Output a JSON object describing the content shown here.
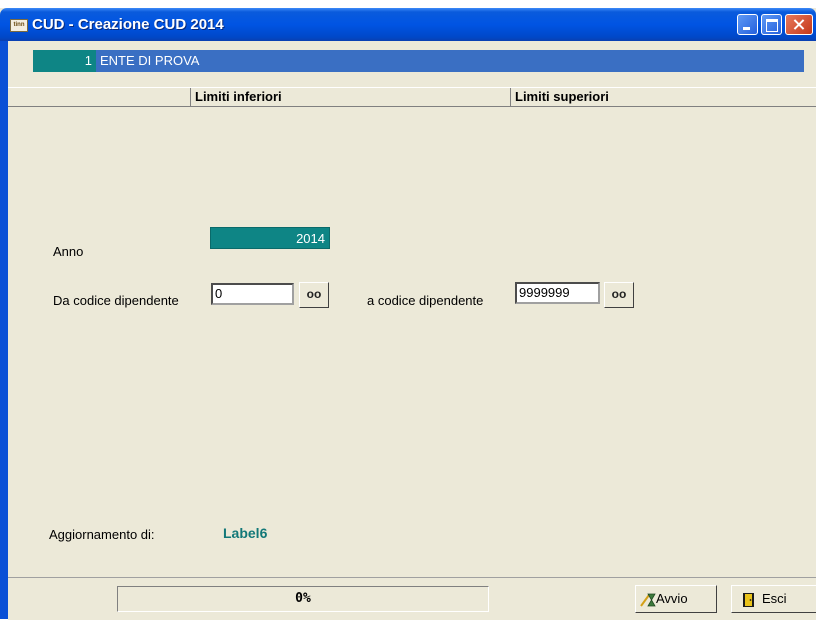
{
  "window": {
    "title": "CUD - Creazione CUD 2014",
    "icon_text": "tinn"
  },
  "ente": {
    "code": "1",
    "name": "ENTE DI PROVA"
  },
  "columns": {
    "lower": "Limiti inferiori",
    "upper": "Limiti superiori"
  },
  "form": {
    "anno_label": "Anno",
    "anno_value": "2014",
    "from_label": "Da codice dipendente",
    "from_value": "0",
    "to_label": "a codice dipendente",
    "to_value": "9999999",
    "lookup_glyph": "oo"
  },
  "update": {
    "label": "Aggiornamento di:",
    "value": "Label6"
  },
  "status": {
    "progress_text": "0%",
    "progress_fraction": 0
  },
  "buttons": {
    "avvio": "Avvio",
    "esci": "Esci"
  },
  "colors": {
    "teal": "#0e8585",
    "ente_bar": "#3a6fc3",
    "label6": "#127878",
    "titlebar": "#0054e3"
  },
  "icons": [
    "window-app-icon",
    "minimize-icon",
    "maximize-icon",
    "close-icon",
    "lookup-glasses-icon",
    "hourglass-icon",
    "door-exit-icon"
  ]
}
